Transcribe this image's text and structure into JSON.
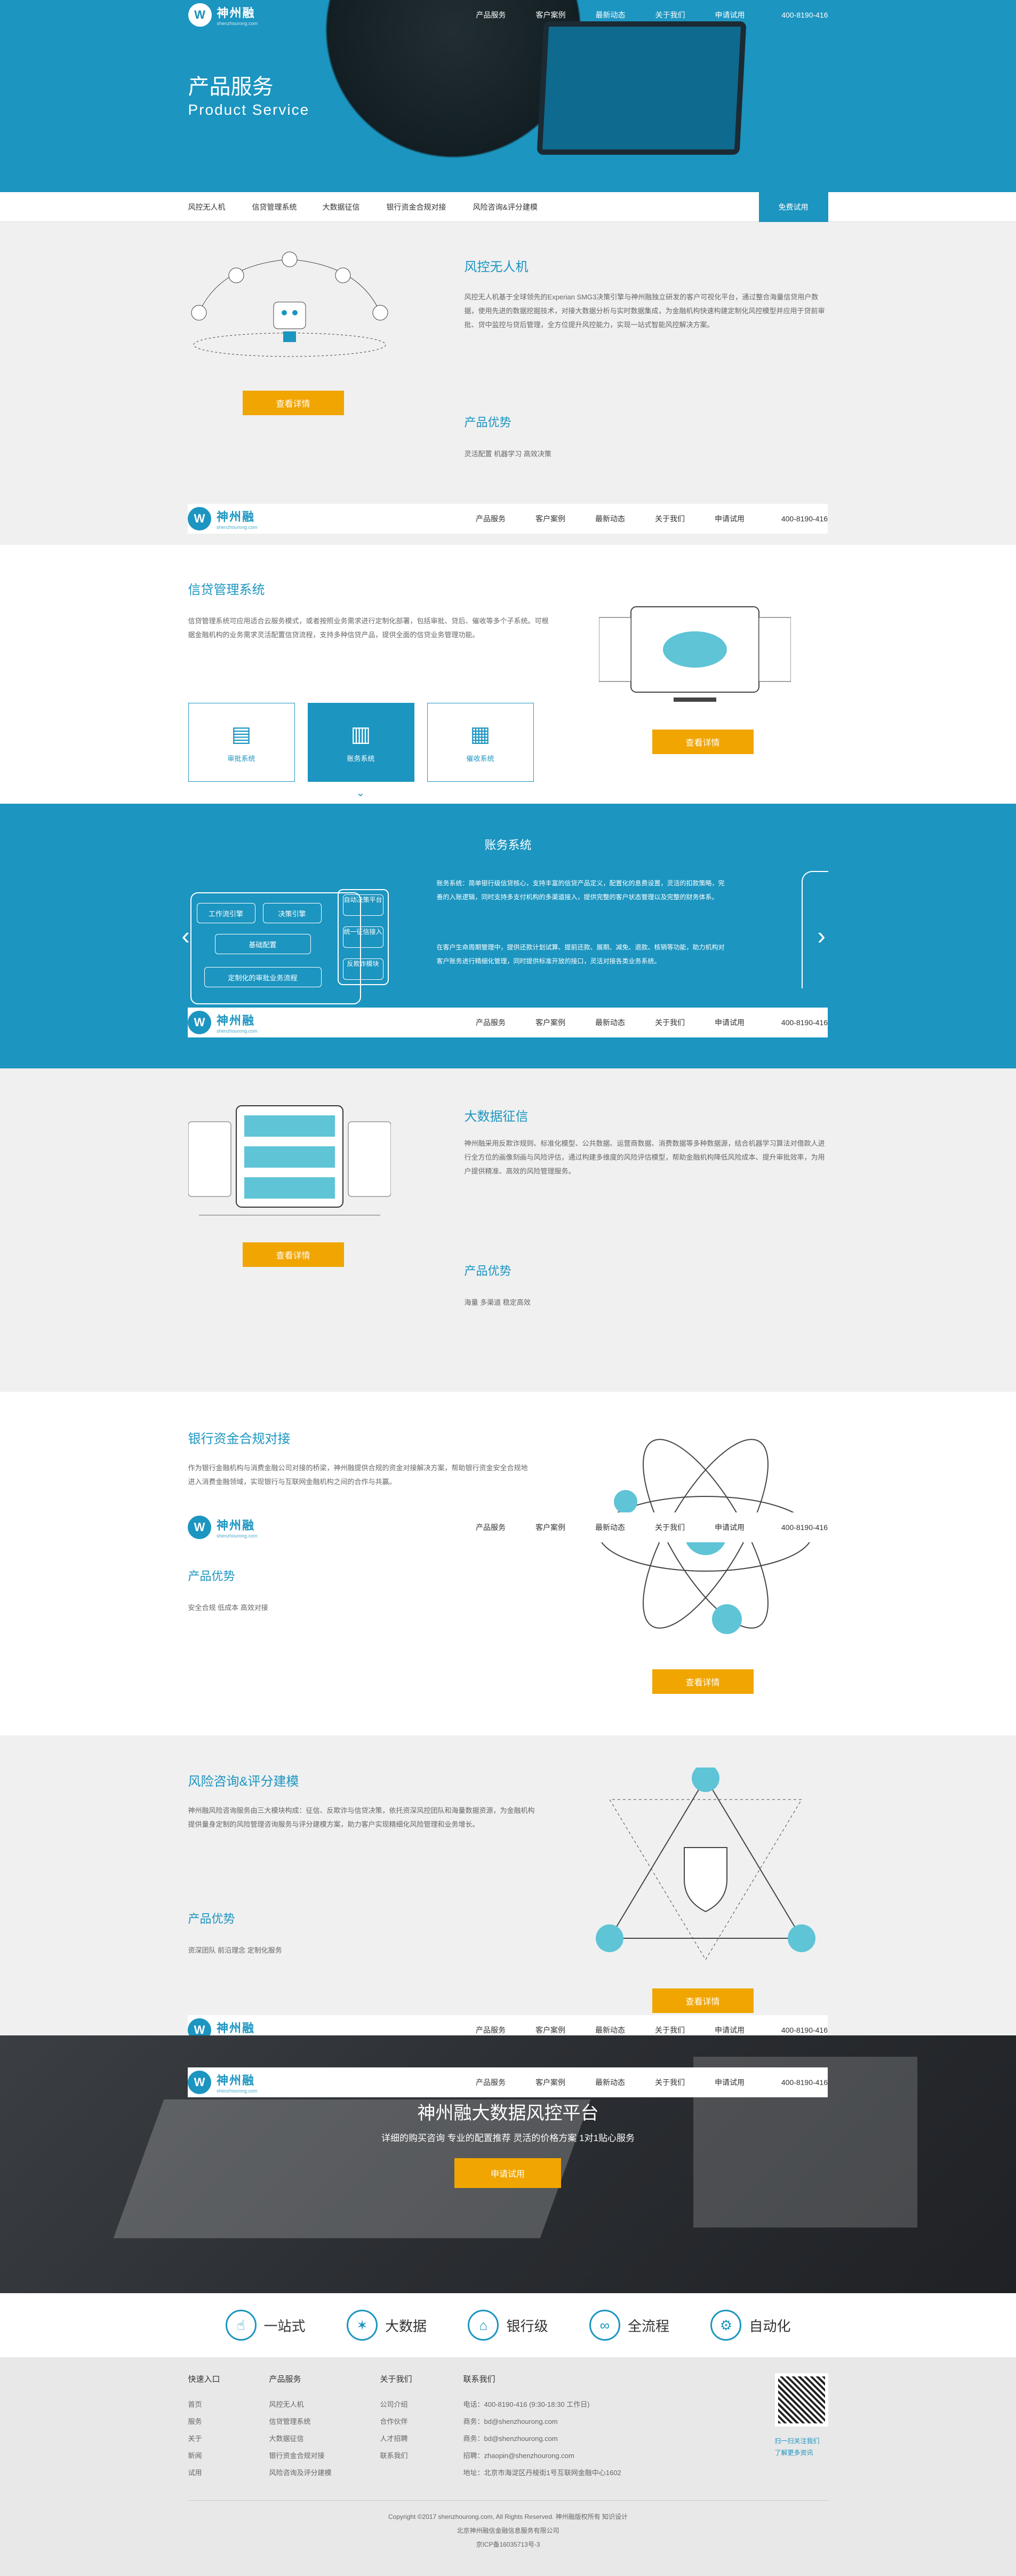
{
  "nav": {
    "logo_text": "神州融",
    "logo_sub": "shenzhourong.com",
    "links": [
      "产品服务",
      "客户案例",
      "最新动态",
      "关于我们",
      "申请试用"
    ],
    "phone": "400-8190-416"
  },
  "hero": {
    "title": "产品服务",
    "subtitle": "Product Service"
  },
  "subnav": {
    "tabs": [
      "风控无人机",
      "信贷管理系统",
      "大数据征信",
      "银行资金合规对接",
      "风险咨询&评分建模"
    ],
    "trial": "免费试用"
  },
  "section1": {
    "title": "风控无人机",
    "text": "风控无人机基于全球领先的Experian SMG3决策引擎与神州融独立研发的客户可视化平台，通过整合海量信贷用户数据，使用先进的数据挖掘技术，对接大数据分析与实时数据集成，为金融机构快速构建定制化风控模型并应用于贷前审批、贷中监控与贷后管理，全方位提升风控能力，实现一站式智能风控解决方案。",
    "button": "查看详情",
    "adv_title": "产品优势",
    "adv_tags": "灵活配置 机器学习 高效决策"
  },
  "section2": {
    "title": "信贷管理系统",
    "text": "信贷管理系统可应用适合云服务模式，或者按照业务需求进行定制化部署，包括审批、贷后、催收等多个子系统。可根据金融机构的业务需求灵活配置信贷流程，支持多种信贷产品，提供全面的信贷业务管理功能。",
    "cards": [
      "审批系统",
      "账务系统",
      "催收系统"
    ],
    "button": "查看详情"
  },
  "section3": {
    "title": "账务系统",
    "text1": "账务系统：简单银行级信贷核心，支持丰富的信贷产品定义，配置化的息费设置，灵活的扣款策略，完善的入账逻辑，同时支持多支付机构的多渠道接入，提供完整的客户状态管理以及完整的财务体系。",
    "text2": "在客户生命周期管理中，提供还款计划试算、提前还款、展期、减免、退款、核销等功能，助力机构对客户账务进行精细化管理，同时提供标准开放的接口，灵活对接各类业务系统。",
    "boxes": [
      "自动决策平台",
      "统一征信接入",
      "反欺诈模块"
    ],
    "left_boxes": [
      "工作流引擎",
      "决策引擎",
      "基础配置",
      "定制化的审批业务流程"
    ]
  },
  "section4": {
    "title": "大数据征信",
    "text": "神州融采用反欺诈规则、标准化模型、公共数据、运营商数据、消费数据等多种数据源，结合机器学习算法对借款人进行全方位的画像刻画与风险评估，通过构建多维度的风险评估模型，帮助金融机构降低风险成本、提升审批效率，为用户提供精准、高效的风险管理服务。",
    "button": "查看详情",
    "adv_title": "产品优势",
    "adv_tags": "海量 多渠道 稳定高效"
  },
  "section5": {
    "title": "银行资金合规对接",
    "text": "作为银行金融机构与消费金融公司对接的桥梁，神州融提供合规的资金对接解决方案，帮助银行资金安全合规地进入消费金融领域，实现银行与互联网金融机构之间的合作与共赢。",
    "button": "查看详情",
    "adv_title": "产品优势",
    "adv_tags": "安全合规 低成本 高效对接"
  },
  "section6": {
    "title": "风险咨询&评分建模",
    "text": "神州融风险咨询服务由三大模块构成：征信、反欺诈与信贷决策，依托资深风控团队和海量数据资源，为金融机构提供量身定制的风险管理咨询服务与评分建模方案，助力客户实现精细化风险管理和业务增长。",
    "button": "查看详情",
    "adv_title": "产品优势",
    "adv_tags": "资深团队 前沿理念 定制化服务"
  },
  "banner": {
    "title": "神州融大数据风控平台",
    "subtitle": "详细的购买咨询 专业的配置推荐 灵活的价格方案 1对1贴心服务",
    "button": "申请试用"
  },
  "features": [
    "一站式",
    "大数据",
    "银行级",
    "全流程",
    "自动化"
  ],
  "footer": {
    "cols": [
      {
        "h": "快速入口",
        "items": [
          "首页",
          "服务",
          "关于",
          "新闻",
          "试用"
        ]
      },
      {
        "h": "产品服务",
        "items": [
          "风控无人机",
          "信贷管理系统",
          "大数据征信",
          "银行资金合规对接",
          "风险咨询及评分建模"
        ]
      },
      {
        "h": "关于我们",
        "items": [
          "公司介绍",
          "合作伙伴",
          "人才招聘",
          "联系我们"
        ]
      },
      {
        "h": "联系我们",
        "items": [
          "电话：400-8190-416 (9:30-18:30 工作日)",
          "商务：bd@shenzhourong.com",
          "商务：bd@shenzhourong.com",
          "招聘：zhaopin@shenzhourong.com",
          "地址：北京市海淀区丹棱街1号互联网金融中心1602"
        ]
      }
    ],
    "qr_1": "扫一扫关注我们",
    "qr_2": "了解更多资讯",
    "copyright": "Copyright ©2017 shenzhourong.com, All Rights Reserved. 神州融版权所有 知识设计",
    "company": "北京神州融信金融信息服务有限公司",
    "icp": "京ICP备16035713号-3"
  }
}
